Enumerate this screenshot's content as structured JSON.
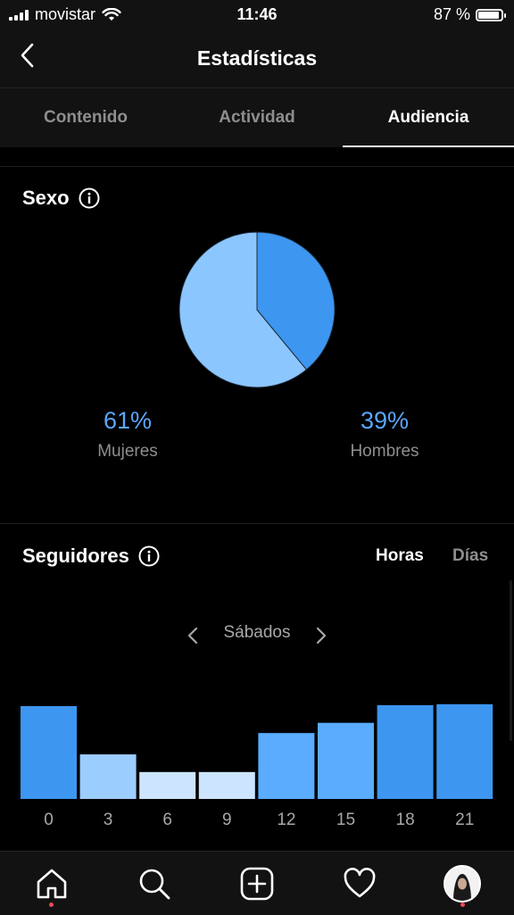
{
  "status_bar": {
    "carrier": "movistar",
    "time": "11:46",
    "battery": "87 %"
  },
  "header": {
    "title": "Estadísticas",
    "back_icon": "chevron-left-icon"
  },
  "tabs": [
    {
      "label": "Contenido",
      "active": false
    },
    {
      "label": "Actividad",
      "active": false
    },
    {
      "label": "Audiencia",
      "active": true
    }
  ],
  "gender": {
    "title": "Sexo",
    "women": {
      "value": "61%",
      "label": "Mujeres",
      "color": "#8cc6ff"
    },
    "men": {
      "value": "39%",
      "label": "Hombres",
      "color": "#3d96f0"
    }
  },
  "followers": {
    "title": "Seguidores",
    "toggle": {
      "hours": "Horas",
      "days": "Días",
      "selected": "Horas"
    },
    "day": "Sábados"
  },
  "chart_data": {
    "type": "bar",
    "categories": [
      "0",
      "3",
      "6",
      "9",
      "12",
      "15",
      "18",
      "21"
    ],
    "values": [
      100,
      48,
      29,
      29,
      71,
      82,
      101,
      102
    ],
    "colors": [
      "#3d96f0",
      "#9ccdff",
      "#cde4ff",
      "#cde4ff",
      "#5aacff",
      "#5aacff",
      "#3d96f0",
      "#3d96f0"
    ],
    "title": "",
    "xlabel": "",
    "ylabel": "",
    "ylim": [
      0,
      110
    ]
  },
  "bottom_nav": [
    {
      "icon": "home-icon",
      "notify": true
    },
    {
      "icon": "search-icon",
      "notify": false
    },
    {
      "icon": "add-icon",
      "notify": false
    },
    {
      "icon": "heart-icon",
      "notify": false
    },
    {
      "icon": "profile-avatar",
      "notify": true
    }
  ]
}
